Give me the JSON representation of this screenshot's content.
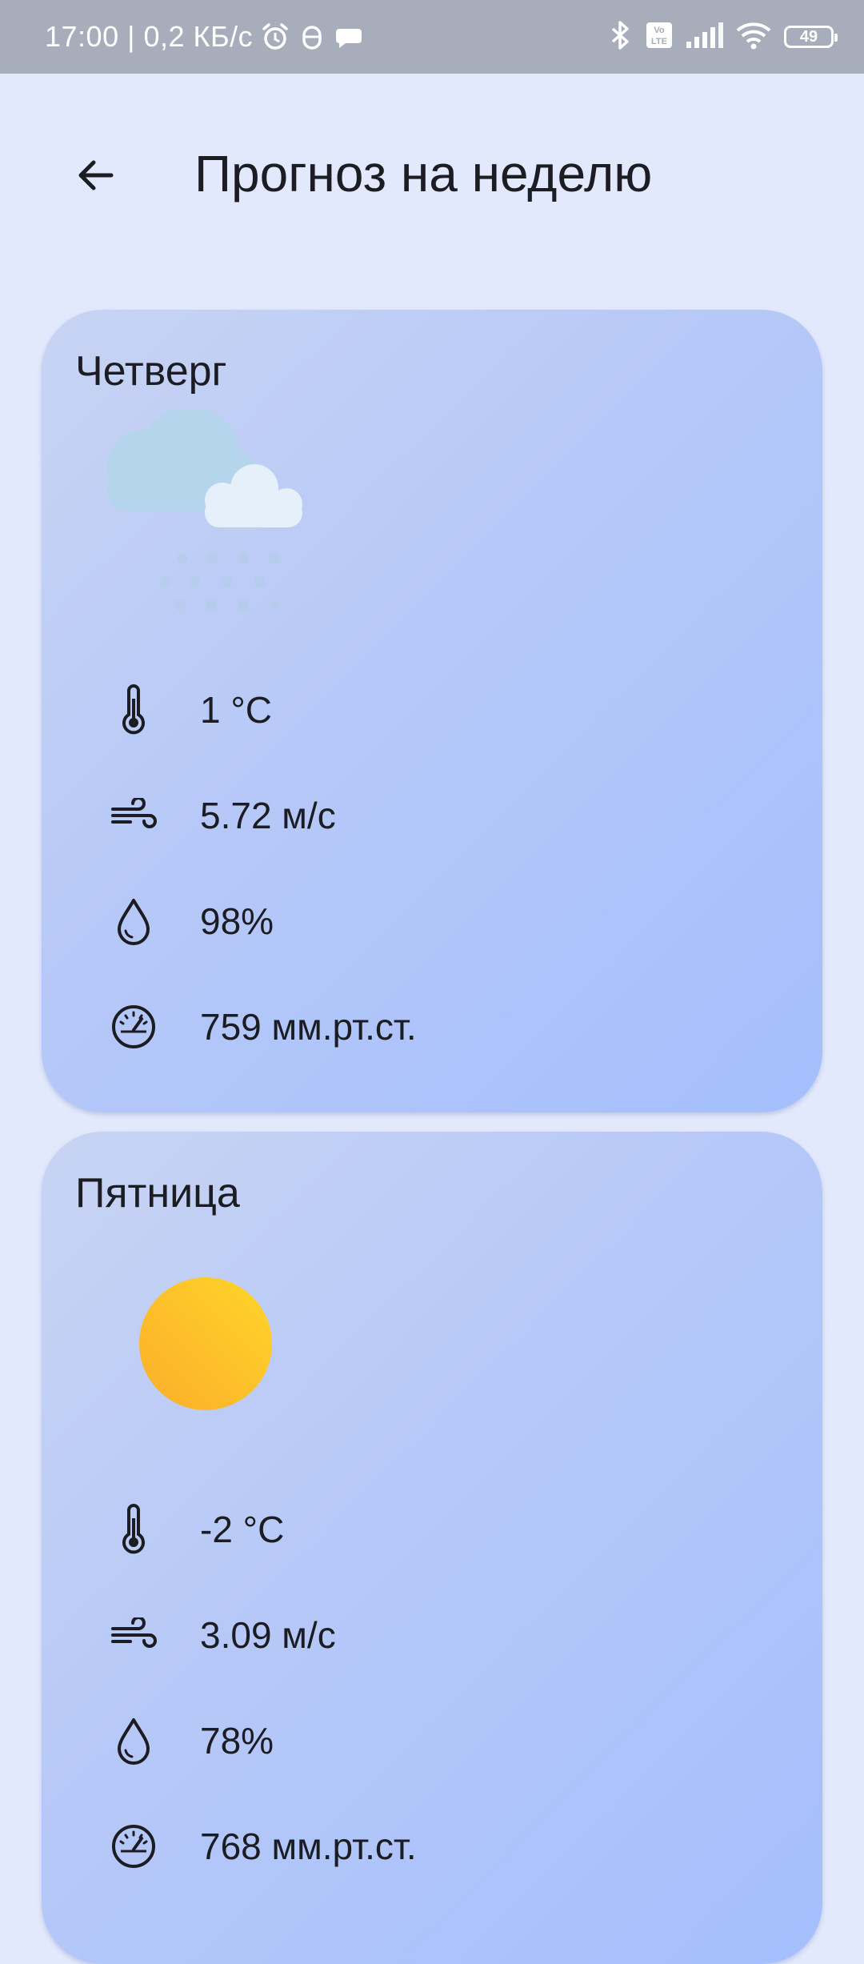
{
  "status_bar": {
    "time_speed": "17:00 | 0,2 КБ/с",
    "battery_level": "49",
    "icons": [
      "alarm-icon",
      "bug-icon",
      "chat-bubble-icon",
      "bluetooth-icon",
      "volte-icon",
      "signal-icon",
      "wifi-icon",
      "battery-icon"
    ]
  },
  "header": {
    "title": "Прогноз на неделю",
    "back_icon": "arrow-back-icon"
  },
  "forecast": [
    {
      "day": "Четверг",
      "weather_icon": "cloud-snow-icon",
      "temperature": "1 °C",
      "wind": "5.72 м/с",
      "humidity": "98%",
      "pressure": "759 мм.рт.ст."
    },
    {
      "day": "Пятница",
      "weather_icon": "sun-icon",
      "temperature": "-2 °C",
      "wind": "3.09 м/с",
      "humidity": "78%",
      "pressure": "768 мм.рт.ст."
    }
  ],
  "colors": {
    "background": "#e3e9fd",
    "status_bar": "#a7adba",
    "card_start": "#c8d4f3",
    "card_end": "#a4bffd",
    "sun": "#fdbb27",
    "text": "#1b1d22"
  }
}
